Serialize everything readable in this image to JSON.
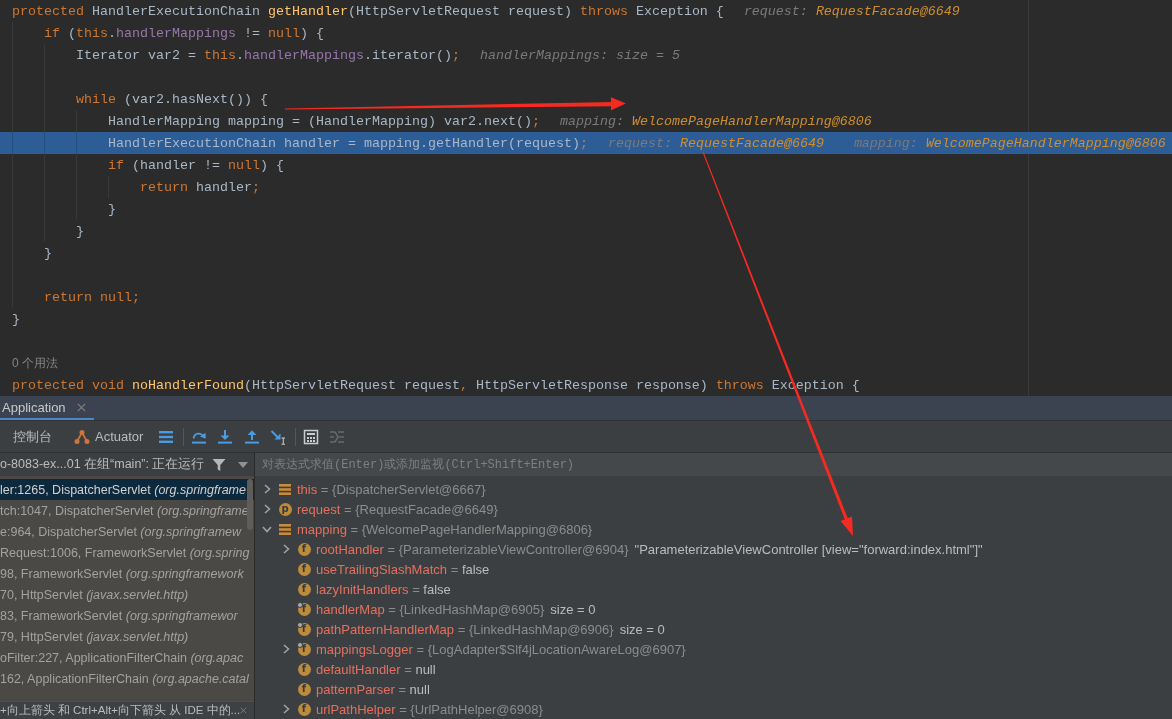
{
  "editor": {
    "lines": [
      {
        "kind": "code",
        "current": false,
        "tokens": [
          {
            "kind": "keyword",
            "text": "protected"
          },
          {
            "kind": "plain",
            "text": " HandlerExecutionChain "
          },
          {
            "kind": "declaration",
            "text": "getHandler"
          },
          {
            "kind": "plain",
            "text": "(HttpServletRequest request) "
          },
          {
            "kind": "keyword",
            "text": "throws"
          },
          {
            "kind": "plain",
            "text": " Exception {"
          }
        ],
        "hints": [
          {
            "label": "request:",
            "value": "RequestFacade@6649",
            "kind": "reference"
          }
        ],
        "children": [
          {
            "kind": "code",
            "current": false,
            "tokens": [
              {
                "kind": "keyword",
                "text": "if"
              },
              {
                "kind": "plain",
                "text": " ("
              },
              {
                "kind": "keyword",
                "text": "this"
              },
              {
                "kind": "plain",
                "text": "."
              },
              {
                "kind": "field",
                "text": "handlerMappings"
              },
              {
                "kind": "plain",
                "text": " != "
              },
              {
                "kind": "keyword",
                "text": "null"
              },
              {
                "kind": "plain",
                "text": ") {"
              }
            ],
            "children": [
              {
                "kind": "code",
                "current": false,
                "tokens": [
                  {
                    "kind": "plain",
                    "text": "Iterator var2 = "
                  },
                  {
                    "kind": "keyword",
                    "text": "this"
                  },
                  {
                    "kind": "plain",
                    "text": "."
                  },
                  {
                    "kind": "field",
                    "text": "handlerMappings"
                  },
                  {
                    "kind": "plain",
                    "text": ".iterator()"
                  },
                  {
                    "kind": "punctuation",
                    "text": ";"
                  }
                ],
                "hints": [
                  {
                    "label": "handlerMappings:",
                    "value": "size = 5",
                    "kind": "summary"
                  }
                ]
              },
              {
                "kind": "blank"
              },
              {
                "kind": "code",
                "current": false,
                "tokens": [
                  {
                    "kind": "keyword",
                    "text": "while"
                  },
                  {
                    "kind": "plain",
                    "text": " (var2.hasNext()) {"
                  }
                ],
                "children": [
                  {
                    "kind": "code",
                    "current": false,
                    "tokens": [
                      {
                        "kind": "plain",
                        "text": "HandlerMapping mapping = (HandlerMapping) var2.next()"
                      },
                      {
                        "kind": "punctuation",
                        "text": ";"
                      }
                    ],
                    "hints": [
                      {
                        "label": "mapping:",
                        "value": "WelcomePageHandlerMapping@6806",
                        "kind": "reference"
                      }
                    ]
                  },
                  {
                    "kind": "code",
                    "current": true,
                    "tokens": [
                      {
                        "kind": "plain",
                        "text": "HandlerExecutionChain handler = mapping.getHandler(request)"
                      },
                      {
                        "kind": "punctuation",
                        "text": ";"
                      }
                    ],
                    "hints": [
                      {
                        "label": "request:",
                        "value": "RequestFacade@6649",
                        "kind": "reference"
                      },
                      {
                        "label": "mapping:",
                        "value": "WelcomePageHandlerMapping@6806",
                        "kind": "reference"
                      }
                    ]
                  },
                  {
                    "kind": "code",
                    "current": false,
                    "tokens": [
                      {
                        "kind": "keyword",
                        "text": "if"
                      },
                      {
                        "kind": "plain",
                        "text": " (handler != "
                      },
                      {
                        "kind": "keyword",
                        "text": "null"
                      },
                      {
                        "kind": "plain",
                        "text": ") {"
                      }
                    ],
                    "children": [
                      {
                        "kind": "code",
                        "current": false,
                        "tokens": [
                          {
                            "kind": "keyword",
                            "text": "return"
                          },
                          {
                            "kind": "plain",
                            "text": " handler"
                          },
                          {
                            "kind": "punctuation",
                            "text": ";"
                          }
                        ]
                      }
                    ]
                  },
                  {
                    "kind": "code",
                    "current": false,
                    "tokens": [
                      {
                        "kind": "plain",
                        "text": "}"
                      }
                    ]
                  }
                ]
              },
              {
                "kind": "code",
                "current": false,
                "tokens": [
                  {
                    "kind": "plain",
                    "text": "}"
                  }
                ]
              }
            ]
          },
          {
            "kind": "code",
            "current": false,
            "tokens": [
              {
                "kind": "plain",
                "text": "}"
              }
            ]
          },
          {
            "kind": "blank"
          },
          {
            "kind": "code",
            "current": false,
            "tokens": [
              {
                "kind": "keyword",
                "text": "return null"
              },
              {
                "kind": "punctuation",
                "text": ";"
              }
            ]
          }
        ]
      },
      {
        "kind": "code",
        "current": false,
        "tokens": [
          {
            "kind": "plain",
            "text": "}"
          }
        ]
      },
      {
        "kind": "blank"
      },
      {
        "kind": "usage",
        "text": "0 个用法"
      },
      {
        "kind": "code",
        "current": false,
        "tokens": [
          {
            "kind": "keyword",
            "text": "protected void "
          },
          {
            "kind": "declaration",
            "text": "noHandlerFound"
          },
          {
            "kind": "plain",
            "text": "(HttpServletRequest request"
          },
          {
            "kind": "punctuation",
            "text": ","
          },
          {
            "kind": "plain",
            "text": " HttpServletResponse response) "
          },
          {
            "kind": "keyword",
            "text": "throws"
          },
          {
            "kind": "plain",
            "text": " Exception {"
          }
        ]
      }
    ]
  },
  "tool_window": {
    "tabs": [
      {
        "label": "Application",
        "selected": true
      }
    ],
    "toolbar": {
      "tabs": [
        {
          "label": "控制台",
          "kind": "text",
          "selected": false
        },
        {
          "label": "Actuator",
          "kind": "icon",
          "selected": false
        }
      ],
      "button_groups": [
        {
          "buttons": [
            {
              "disabled": false
            }
          ]
        },
        {
          "buttons": [
            {
              "disabled": false
            },
            {
              "disabled": false
            },
            {
              "disabled": false
            },
            {
              "disabled": false
            }
          ]
        },
        {
          "buttons": [
            {
              "disabled": false
            },
            {
              "disabled": true
            }
          ]
        }
      ]
    },
    "thread_selector": {
      "text": "o-8083-ex...01 在组“main”: 正在运行"
    },
    "frames": [
      {
        "text": "ler:1265, DispatcherServlet *(org.springframe*",
        "selected": true
      },
      {
        "text": "tch:1047, DispatcherServlet *(org.springframe*",
        "selected": false
      },
      {
        "text": "e:964, DispatcherServlet *(org.springframew*",
        "selected": false
      },
      {
        "text": "Request:1006, FrameworkServlet *(org.spring*",
        "selected": false
      },
      {
        "text": "98, FrameworkServlet *(org.springframework*",
        "selected": false
      },
      {
        "text": "70, HttpServlet *(javax.servlet.http)*",
        "selected": false
      },
      {
        "text": "83, FrameworkServlet *(org.springframewor*",
        "selected": false
      },
      {
        "text": "79, HttpServlet *(javax.servlet.http)*",
        "selected": false
      },
      {
        "text": "oFilter:227, ApplicationFilterChain *(org.apac*",
        "selected": false
      },
      {
        "text": "162, ApplicationFilterChain *(org.apache.catal*",
        "selected": false
      }
    ],
    "hint_popup": {
      "text": "+向上箭头 和 Ctrl+Alt+向下箭头 从 IDE 中的..."
    },
    "evaluate_field": {
      "placeholder": "对表达式求值(Enter)或添加监视(Ctrl+Shift+Enter)"
    },
    "variables": [
      {
        "kind": "variable",
        "name": "this",
        "op": "=",
        "value": "{DispatcherServlet@6667}",
        "expanded": false
      },
      {
        "kind": "parameter",
        "badge": "p",
        "overlay": false,
        "name": "request",
        "op": "=",
        "value": "{RequestFacade@6649}",
        "expanded": false
      },
      {
        "kind": "variable",
        "name": "mapping",
        "op": "=",
        "value": "{WelcomePageHandlerMapping@6806}",
        "expanded": true,
        "children": [
          {
            "kind": "field",
            "badge": "f",
            "overlay": false,
            "name": "rootHandler",
            "op": "=",
            "value": "{ParameterizableViewController@6904}",
            "extra": "\"ParameterizableViewController [view=\"forward:index.html\"]\"",
            "expanded": false
          },
          {
            "kind": "field",
            "badge": "f",
            "overlay": false,
            "name": "useTrailingSlashMatch",
            "op": "=",
            "literal": "false"
          },
          {
            "kind": "field",
            "badge": "f",
            "overlay": false,
            "name": "lazyInitHandlers",
            "op": "=",
            "literal": "false"
          },
          {
            "kind": "field",
            "badge": "f",
            "overlay": true,
            "name": "handlerMap",
            "op": "=",
            "value": "{LinkedHashMap@6905}",
            "extra": "size = 0"
          },
          {
            "kind": "field",
            "badge": "f",
            "overlay": true,
            "name": "pathPatternHandlerMap",
            "op": "=",
            "value": "{LinkedHashMap@6906}",
            "extra": "size = 0"
          },
          {
            "kind": "field",
            "badge": "f",
            "overlay": true,
            "name": "mappingsLogger",
            "op": "=",
            "value": "{LogAdapter$Slf4jLocationAwareLog@6907}",
            "expanded": false
          },
          {
            "kind": "field",
            "badge": "f",
            "overlay": false,
            "name": "defaultHandler",
            "op": "=",
            "literal": "null"
          },
          {
            "kind": "field",
            "badge": "f",
            "overlay": false,
            "name": "patternParser",
            "op": "=",
            "literal": "null"
          },
          {
            "kind": "field",
            "badge": "f",
            "overlay": false,
            "name": "urlPathHelper",
            "op": "=",
            "value": "{UrlPathHelper@6908}",
            "expanded": false
          }
        ]
      }
    ]
  }
}
